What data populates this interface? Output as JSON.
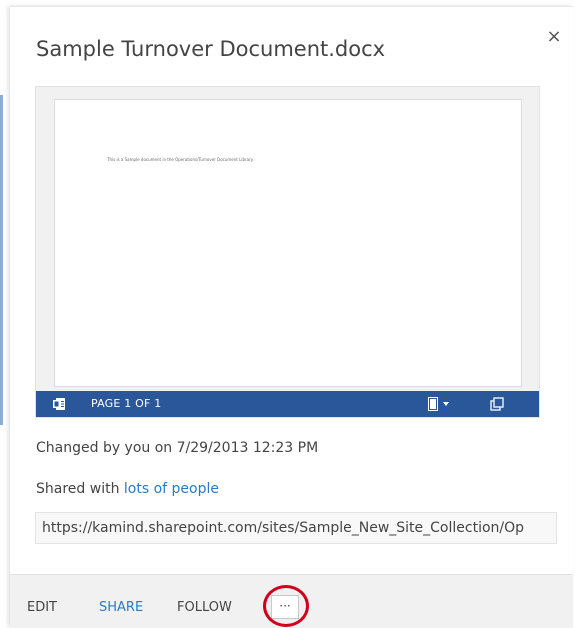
{
  "callout": {
    "title": "Sample Turnover Document.docx",
    "close_glyph": "×"
  },
  "preview": {
    "body_text": "This is a Sample document in the Operations/Turnover Document Library.",
    "page_label": "PAGE 1 OF 1",
    "viewer_bar_color": "#2a579a",
    "icons": [
      "word-icon",
      "view-mode-icon",
      "popout-icon"
    ]
  },
  "details": {
    "changed": "Changed by you on 7/29/2013 12:23 PM",
    "shared_prefix": "Shared with ",
    "shared_link": "lots of people",
    "url": "https://kamind.sharepoint.com/sites/Sample_New_Site_Collection/Op"
  },
  "actions": {
    "edit": "EDIT",
    "share": "SHARE",
    "follow": "FOLLOW",
    "more": "···"
  },
  "colors": {
    "link": "#2b79c4",
    "highlight": "#d0021b",
    "text": "#444444"
  }
}
